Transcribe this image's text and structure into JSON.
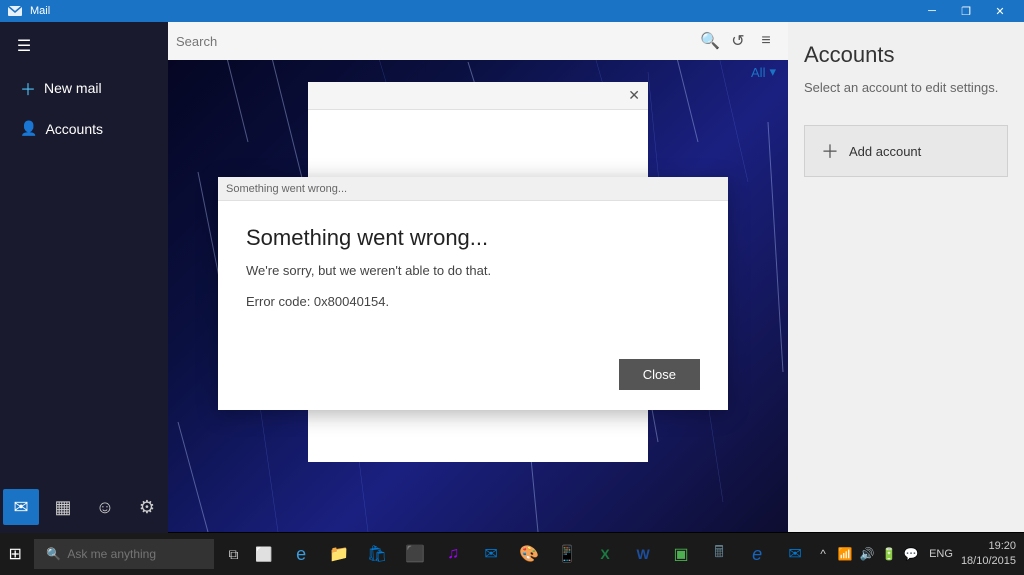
{
  "titlebar": {
    "title": "Mail",
    "min_btn": "─",
    "restore_btn": "❐",
    "close_btn": "✕"
  },
  "sidebar": {
    "new_mail_label": "New mail",
    "accounts_label": "Accounts",
    "hamburger": "☰"
  },
  "search": {
    "placeholder": "Search",
    "filter_label": "All"
  },
  "right_panel": {
    "title": "Accounts",
    "subtitle": "Select an account to edit settings.",
    "add_account_label": "Add account"
  },
  "bg_dialog": {
    "title": ""
  },
  "error_dialog": {
    "titlebar_text": "Something went wrong...",
    "title": "Something went wrong...",
    "subtitle": "We're sorry, but we weren't able to do that.",
    "error_code": "Error code: 0x80040154.",
    "close_btn_label": "Close"
  },
  "taskbar": {
    "search_placeholder": "Ask me anything",
    "time": "19:20",
    "date": "18/10/2015",
    "lang": "ENG"
  },
  "sidebar_bottom": {
    "mail_icon": "✉",
    "calendar_icon": "▦",
    "emoji_icon": "☺",
    "settings_icon": "⚙"
  }
}
